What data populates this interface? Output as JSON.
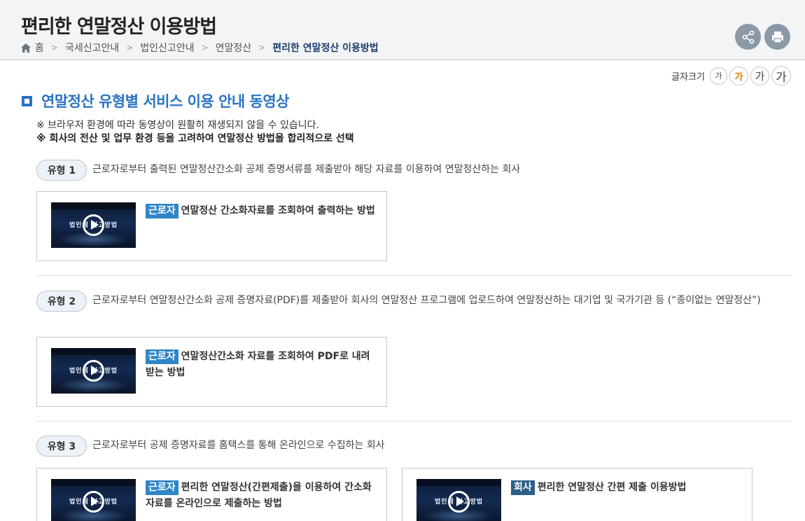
{
  "header": {
    "title": "편리한 연말정산 이용방법",
    "breadcrumb": [
      "홈",
      "국세신고안내",
      "법인신고안내",
      "연말정산",
      "편리한 연말정산 이용방법"
    ],
    "icons": {
      "home": "home-icon",
      "share": "share-icon",
      "print": "print-icon"
    }
  },
  "font_size": {
    "label": "글자크기",
    "options": [
      "가",
      "가",
      "가",
      "가"
    ],
    "selected_index": 1
  },
  "section": {
    "title": "연말정산 유형별 서비스 이용 안내 동영상",
    "notes": [
      "※ 브라우저 환경에 따라 동영상이 원활히 재생되지 않을 수 있습니다.",
      "※ 회사의 전산 및 업무 환경 등을 고려하여 연말정산 방법을 합리적으로 선택"
    ]
  },
  "types": [
    {
      "badge": "유형 1",
      "description": "근로자로부터 출력된 연말정산간소화 공제 증명서류를 제출받아 해당 자료를 이용하여 연말정산하는 회사",
      "videos": [
        {
          "tag": "근로자",
          "title": "연말정산 간소화자료를 조회하여 출력하는 방법",
          "thumb_text": "법인세 신고방법"
        }
      ]
    },
    {
      "badge": "유형 2",
      "description": "근로자로부터 연말정산간소화 공제 증명자료(PDF)를 제출받아 회사의 연말정산 프로그램에 업로드하여 연말정산하는 대기업 및 국가기관 등 (“종이없는 연말정산”)",
      "videos": [
        {
          "tag": "근로자",
          "title": "연말정산간소화 자료를 조회하여 PDF로 내려받는 방법",
          "thumb_text": "법인세 신고방법"
        }
      ]
    },
    {
      "badge": "유형 3",
      "description": "근로자로부터 공제 증명자료를 홈택스를 통해 온라인으로 수집하는 회사",
      "videos": [
        {
          "tag": "근로자",
          "title": "편리한 연말정산(간편제출)을 이용하여 간소화자료를 온라인으로 제출하는 방법",
          "thumb_text": "법인세 신고방법"
        },
        {
          "tag": "회사",
          "title": "편리한 연말정산 간편 제출 이용방법",
          "thumb_text": "법인세 신고방법"
        }
      ]
    }
  ],
  "colors": {
    "accent": "#2a73c3",
    "tag_worker": "#2f86c6",
    "tag_company": "#2b5f87",
    "current_breadcrumb": "#1d3d6b"
  }
}
